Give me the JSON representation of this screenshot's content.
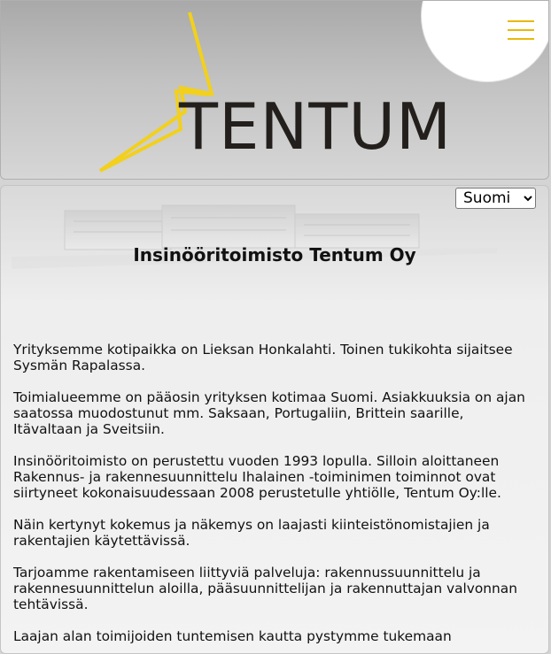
{
  "header": {
    "logo_text": "TENTUM",
    "menu_icon": "hamburger-menu-icon",
    "accent_color": "#f2d01c"
  },
  "language": {
    "selected": "Suomi",
    "options": [
      "Suomi"
    ]
  },
  "main": {
    "title": "Insinööritoimisto Tentum Oy",
    "paragraphs": [
      "Yrityksemme kotipaikka on Lieksan Honkalahti. Toinen tukikohta sijaitsee Sysmän Rapalassa.",
      "Toimialueemme on pääosin yrityksen kotimaa Suomi. Asiakkuuksia on ajan saatossa muodostunut mm. Saksaan, Portugaliin, Brittein saarille, Itävaltaan ja Sveitsiin.",
      "Insinööritoimisto on perustettu vuoden 1993 lopulla. Silloin aloittaneen Rakennus- ja rakennesuunnittelu Ihalainen -toiminimen toiminnot ovat siirtyneet kokonaisuudessaan 2008 perustetulle yhtiölle, Tentum Oy:lle.",
      "Näin kertynyt kokemus ja näkemys on laajasti kiinteistönomistajien ja rakentajien käytettävissä.",
      "Tarjoamme rakentamiseen liittyviä palveluja: rakennussuunnittelu ja rakennesuunnittelun aloilla, pääsuunnittelijan ja rakennuttajan valvonnan tehtävissä.",
      "Laajan alan toimijoiden tuntemisen kautta pystymme tukemaan"
    ]
  }
}
